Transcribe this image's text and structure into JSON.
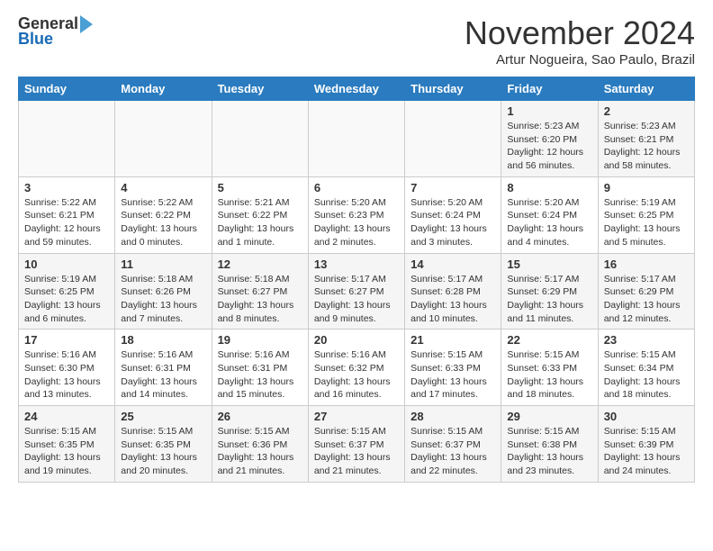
{
  "logo": {
    "general": "General",
    "blue": "Blue"
  },
  "title": "November 2024",
  "subtitle": "Artur Nogueira, Sao Paulo, Brazil",
  "days_of_week": [
    "Sunday",
    "Monday",
    "Tuesday",
    "Wednesday",
    "Thursday",
    "Friday",
    "Saturday"
  ],
  "weeks": [
    [
      {
        "day": "",
        "info": ""
      },
      {
        "day": "",
        "info": ""
      },
      {
        "day": "",
        "info": ""
      },
      {
        "day": "",
        "info": ""
      },
      {
        "day": "",
        "info": ""
      },
      {
        "day": "1",
        "info": "Sunrise: 5:23 AM\nSunset: 6:20 PM\nDaylight: 12 hours and 56 minutes."
      },
      {
        "day": "2",
        "info": "Sunrise: 5:23 AM\nSunset: 6:21 PM\nDaylight: 12 hours and 58 minutes."
      }
    ],
    [
      {
        "day": "3",
        "info": "Sunrise: 5:22 AM\nSunset: 6:21 PM\nDaylight: 12 hours and 59 minutes."
      },
      {
        "day": "4",
        "info": "Sunrise: 5:22 AM\nSunset: 6:22 PM\nDaylight: 13 hours and 0 minutes."
      },
      {
        "day": "5",
        "info": "Sunrise: 5:21 AM\nSunset: 6:22 PM\nDaylight: 13 hours and 1 minute."
      },
      {
        "day": "6",
        "info": "Sunrise: 5:20 AM\nSunset: 6:23 PM\nDaylight: 13 hours and 2 minutes."
      },
      {
        "day": "7",
        "info": "Sunrise: 5:20 AM\nSunset: 6:24 PM\nDaylight: 13 hours and 3 minutes."
      },
      {
        "day": "8",
        "info": "Sunrise: 5:20 AM\nSunset: 6:24 PM\nDaylight: 13 hours and 4 minutes."
      },
      {
        "day": "9",
        "info": "Sunrise: 5:19 AM\nSunset: 6:25 PM\nDaylight: 13 hours and 5 minutes."
      }
    ],
    [
      {
        "day": "10",
        "info": "Sunrise: 5:19 AM\nSunset: 6:25 PM\nDaylight: 13 hours and 6 minutes."
      },
      {
        "day": "11",
        "info": "Sunrise: 5:18 AM\nSunset: 6:26 PM\nDaylight: 13 hours and 7 minutes."
      },
      {
        "day": "12",
        "info": "Sunrise: 5:18 AM\nSunset: 6:27 PM\nDaylight: 13 hours and 8 minutes."
      },
      {
        "day": "13",
        "info": "Sunrise: 5:17 AM\nSunset: 6:27 PM\nDaylight: 13 hours and 9 minutes."
      },
      {
        "day": "14",
        "info": "Sunrise: 5:17 AM\nSunset: 6:28 PM\nDaylight: 13 hours and 10 minutes."
      },
      {
        "day": "15",
        "info": "Sunrise: 5:17 AM\nSunset: 6:29 PM\nDaylight: 13 hours and 11 minutes."
      },
      {
        "day": "16",
        "info": "Sunrise: 5:17 AM\nSunset: 6:29 PM\nDaylight: 13 hours and 12 minutes."
      }
    ],
    [
      {
        "day": "17",
        "info": "Sunrise: 5:16 AM\nSunset: 6:30 PM\nDaylight: 13 hours and 13 minutes."
      },
      {
        "day": "18",
        "info": "Sunrise: 5:16 AM\nSunset: 6:31 PM\nDaylight: 13 hours and 14 minutes."
      },
      {
        "day": "19",
        "info": "Sunrise: 5:16 AM\nSunset: 6:31 PM\nDaylight: 13 hours and 15 minutes."
      },
      {
        "day": "20",
        "info": "Sunrise: 5:16 AM\nSunset: 6:32 PM\nDaylight: 13 hours and 16 minutes."
      },
      {
        "day": "21",
        "info": "Sunrise: 5:15 AM\nSunset: 6:33 PM\nDaylight: 13 hours and 17 minutes."
      },
      {
        "day": "22",
        "info": "Sunrise: 5:15 AM\nSunset: 6:33 PM\nDaylight: 13 hours and 18 minutes."
      },
      {
        "day": "23",
        "info": "Sunrise: 5:15 AM\nSunset: 6:34 PM\nDaylight: 13 hours and 18 minutes."
      }
    ],
    [
      {
        "day": "24",
        "info": "Sunrise: 5:15 AM\nSunset: 6:35 PM\nDaylight: 13 hours and 19 minutes."
      },
      {
        "day": "25",
        "info": "Sunrise: 5:15 AM\nSunset: 6:35 PM\nDaylight: 13 hours and 20 minutes."
      },
      {
        "day": "26",
        "info": "Sunrise: 5:15 AM\nSunset: 6:36 PM\nDaylight: 13 hours and 21 minutes."
      },
      {
        "day": "27",
        "info": "Sunrise: 5:15 AM\nSunset: 6:37 PM\nDaylight: 13 hours and 21 minutes."
      },
      {
        "day": "28",
        "info": "Sunrise: 5:15 AM\nSunset: 6:37 PM\nDaylight: 13 hours and 22 minutes."
      },
      {
        "day": "29",
        "info": "Sunrise: 5:15 AM\nSunset: 6:38 PM\nDaylight: 13 hours and 23 minutes."
      },
      {
        "day": "30",
        "info": "Sunrise: 5:15 AM\nSunset: 6:39 PM\nDaylight: 13 hours and 24 minutes."
      }
    ]
  ]
}
